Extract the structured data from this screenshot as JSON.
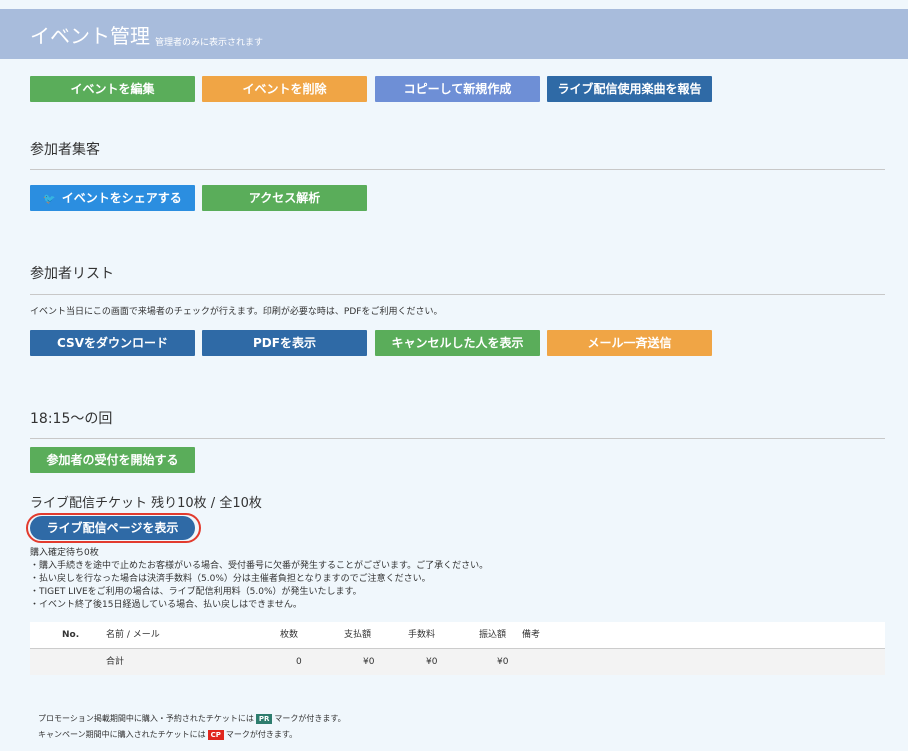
{
  "header": {
    "title": "イベント管理",
    "subtitle": "管理者のみに表示されます"
  },
  "toolbar": {
    "edit": "イベントを編集",
    "delete": "イベントを削除",
    "copy": "コピーして新規作成",
    "report": "ライブ配信使用楽曲を報告"
  },
  "attract": {
    "title": "参加者集客",
    "share": "イベントをシェアする",
    "analytics": "アクセス解析"
  },
  "participants": {
    "title": "参加者リスト",
    "description": "イベント当日にこの画面で来場者のチェックが行えます。印刷が必要な時は、PDFをご利用ください。",
    "csv": "CSVをダウンロード",
    "pdf": "PDFを表示",
    "cancelled": "キャンセルした人を表示",
    "mail": "メール一斉送信"
  },
  "session": {
    "title": "18:15〜の回",
    "start_reception": "参加者の受付を開始する",
    "ticket_title": "ライブ配信チケット 残り10枚 / 全10枚",
    "live_page": "ライブ配信ページを表示",
    "notes": [
      "購入確定待ち0枚",
      "・購入手続きを途中で止めたお客様がいる場合、受付番号に欠番が発生することがございます。ご了承ください。",
      "・払い戻しを行なった場合は決済手数料（5.0%）分は主催者負担となりますのでご注意ください。",
      "・TIGET LIVEをご利用の場合は、ライブ配信利用料（5.0%）が発生いたします。",
      "・イベント終了後15日経過している場合、払い戻しはできません。"
    ]
  },
  "table": {
    "headers": {
      "no": "No.",
      "name": "名前 / メール",
      "count": "枚数",
      "paid": "支払額",
      "fee": "手数料",
      "transfer": "振込額",
      "remarks": "備考"
    },
    "total": {
      "label": "合計",
      "count": "0",
      "paid": "¥0",
      "fee": "¥0",
      "transfer": "¥0"
    }
  },
  "footer": {
    "pr_before": "プロモーション掲載期間中に購入・予約されたチケットには",
    "pr_badge": "PR",
    "pr_after": "マークが付きます。",
    "cp_before": "キャンペーン期間中に購入されたチケットには",
    "cp_badge": "CP",
    "cp_after": "マークが付きます。"
  },
  "colors": {
    "header": "#a8bcdc",
    "green": "#5aad5a",
    "orange": "#f0a545",
    "lightblue": "#6e8fd6",
    "navy": "#2f6aa6",
    "twitter": "#2b8ee0",
    "highlight": "#e23b2e"
  },
  "icons": {
    "share": "twitter-bird-icon"
  }
}
